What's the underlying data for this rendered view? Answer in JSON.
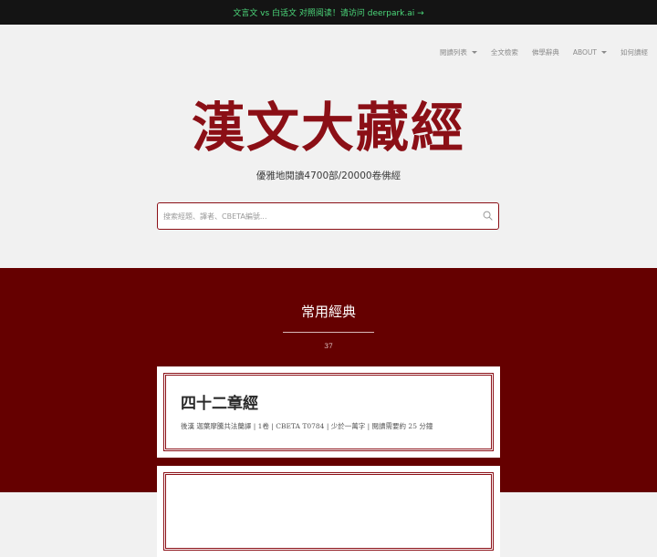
{
  "banner": {
    "text": "文言文 vs 白话文 对照阅读！请访问 deerpark.ai →",
    "color": "#4cd97b"
  },
  "nav": {
    "items": [
      {
        "label": "閱讀列表",
        "has_dropdown": true
      },
      {
        "label": "全文檢索",
        "has_dropdown": false
      },
      {
        "label": "佛學辭典",
        "has_dropdown": false
      },
      {
        "label": "ABOUT",
        "has_dropdown": true
      },
      {
        "label": "如何讀經",
        "has_dropdown": false
      }
    ]
  },
  "hero": {
    "title": "漢文大藏經",
    "subtitle": "優雅地閱讀4700部/20000卷佛經"
  },
  "search": {
    "placeholder": "搜索經題、譯者、CBETA編號...",
    "value": "",
    "icon": "search-icon"
  },
  "featured": {
    "title": "常用經典",
    "count": "37",
    "cards": [
      {
        "title": "四十二章經",
        "meta": "後漢 迦葉摩騰共法蘭譯 | 1卷 | CBETA T0784 | 少於一萬字 | 閱讀需要約 25 分鐘"
      },
      {
        "title": "",
        "meta": ""
      }
    ]
  },
  "colors": {
    "accent": "#8b0f16",
    "section_bg": "#650000",
    "page_bg": "#f1f1f1",
    "banner_bg": "#141414"
  }
}
